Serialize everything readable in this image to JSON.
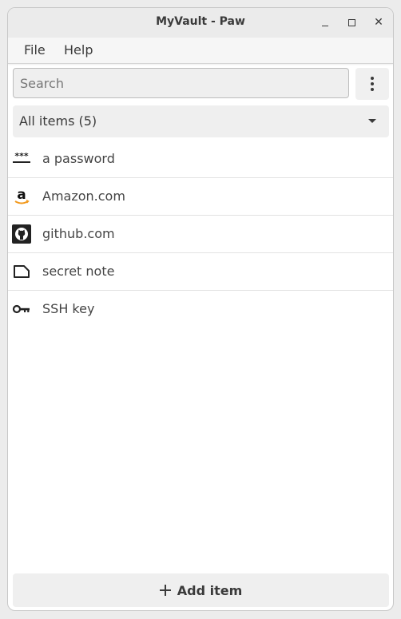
{
  "window": {
    "title": "MyVault - Paw",
    "min_glyph": "minimize-icon",
    "max_glyph": "maximize-icon",
    "close_glyph": "✕"
  },
  "menu": {
    "file": "File",
    "help": "Help"
  },
  "search": {
    "placeholder": "Search",
    "value": ""
  },
  "filter": {
    "label": "All items (5)"
  },
  "items": [
    {
      "label": "a password",
      "icon": "password-icon"
    },
    {
      "label": "Amazon.com",
      "icon": "amazon-logo-icon"
    },
    {
      "label": "github.com",
      "icon": "github-logo-icon"
    },
    {
      "label": "secret note",
      "icon": "note-icon"
    },
    {
      "label": "SSH key",
      "icon": "key-icon"
    }
  ],
  "add_button": {
    "label": "Add item",
    "icon": "plus-icon"
  }
}
